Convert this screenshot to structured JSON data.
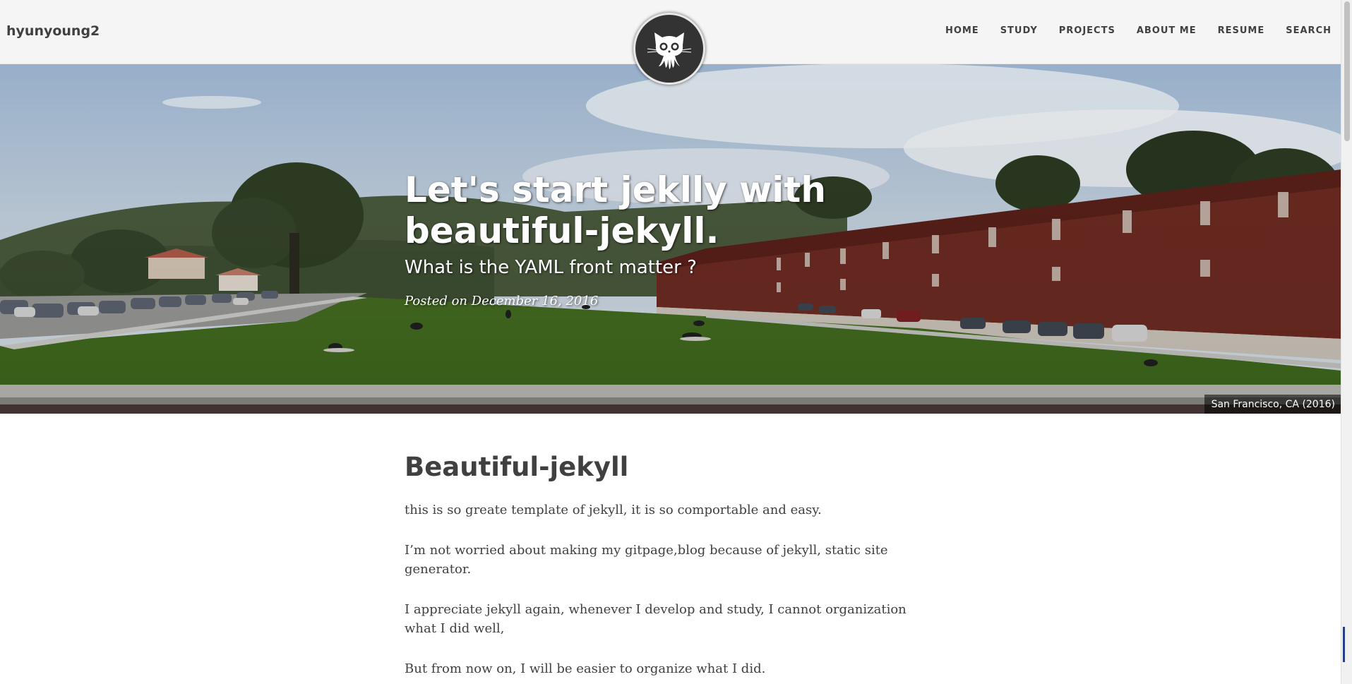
{
  "navbar": {
    "brand": "hyunyoung2",
    "links": [
      "HOME",
      "STUDY",
      "PROJECTS",
      "ABOUT ME",
      "RESUME",
      "SEARCH"
    ]
  },
  "avatar": {
    "icon": "github-octocat-icon"
  },
  "hero": {
    "title": "Let's start jeklly with beautiful-jekyll.",
    "subtitle": "What is the YAML front matter ?",
    "meta": "Posted on December 16, 2016",
    "caption": "San Francisco, CA (2016)"
  },
  "post": {
    "heading": "Beautiful-jekyll",
    "paragraphs": [
      "this is so greate template of jekyll, it is so comportable and easy.",
      "I’m not worried about making my gitpage,blog because of jekyll, static site generator.",
      "I appreciate jekyll again, whenever I develop and study, I cannot organization what I did well,",
      "But from now on, I will be easier to organize what I did."
    ]
  },
  "colors": {
    "navbar_bg": "#f5f5f5",
    "text": "#404040",
    "avatar_bg": "#333333"
  }
}
